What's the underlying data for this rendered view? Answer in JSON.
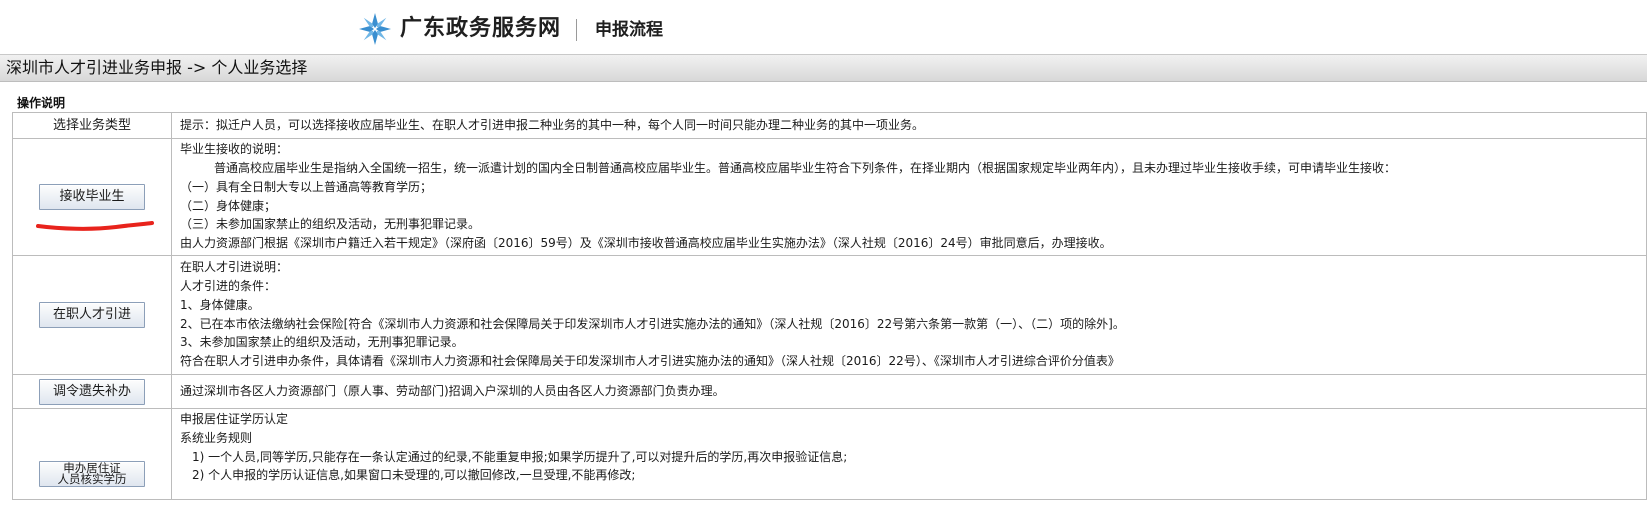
{
  "header": {
    "brand": "广东政务服务网",
    "subtitle": "申报流程",
    "logo_color": "#3a8fd0"
  },
  "breadcrumb": "深圳市人才引进业务申报 -> 个人业务选择",
  "section_label": "操作说明",
  "rows": [
    {
      "left": "选择业务类型",
      "lines": [
        "提示：拟迁户人员，可以选择接收应届毕业生、在职人才引进申报二种业务的其中一种，每个人同一时间只能办理二种业务的其中一项业务。"
      ]
    },
    {
      "button": "接收毕业生",
      "lines": [
        "毕业生接收的说明：",
        "普通高校应届毕业生是指纳入全国统一招生，统一派遣计划的国内全日制普通高校应届毕业生。普通高校应届毕业生符合下列条件，在择业期内（根据国家规定毕业两年内），且未办理过毕业生接收手续，可申请毕业生接收：",
        "（一）具有全日制大专以上普通高等教育学历；",
        "（二）身体健康；",
        "（三）未参加国家禁止的组织及活动，无刑事犯罪记录。",
        "由人力资源部门根据《深圳市户籍迁入若干规定》（深府函〔2016〕59号）及《深圳市接收普通高校应届毕业生实施办法》（深人社规〔2016〕24号）审批同意后，办理接收。"
      ]
    },
    {
      "button": "在职人才引进",
      "lines": [
        "在职人才引进说明：",
        "人才引进的条件：",
        "1、身体健康。",
        "2、已在本市依法缴纳社会保险[符合《深圳市人力资源和社会保障局关于印发深圳市人才引进实施办法的通知》（深人社规〔2016〕22号第六条第一款第（一）、（二）项的除外]。",
        "3、未参加国家禁止的组织及活动，无刑事犯罪记录。",
        "符合在职人才引进申办条件，具体请看《深圳市人力资源和社会保障局关于印发深圳市人才引进实施办法的通知》（深人社规〔2016〕22号）、《深圳市人才引进综合评价分值表》"
      ]
    },
    {
      "button": "调令遗失补办",
      "lines": [
        "通过深圳市各区人力资源部门（原人事、劳动部门)招调入户深圳的人员由各区人力资源部门负责办理。"
      ]
    },
    {
      "button_line1": "申办居住证",
      "button_line2": "人员核实学历",
      "lines": [
        "申报居住证学历认定",
        "系统业务规则",
        "1) 一个人员,同等学历,只能存在一条认定通过的纪录,不能重复申报;如果学历提升了,可以对提升后的学历,再次申报验证信息;",
        "2) 个人申报的学历认证信息,如果窗口未受理的,可以撤回修改,一旦受理,不能再修改;"
      ]
    }
  ],
  "colors": {
    "annotation_red": "#e8231c",
    "border": "#bcbcbc"
  }
}
